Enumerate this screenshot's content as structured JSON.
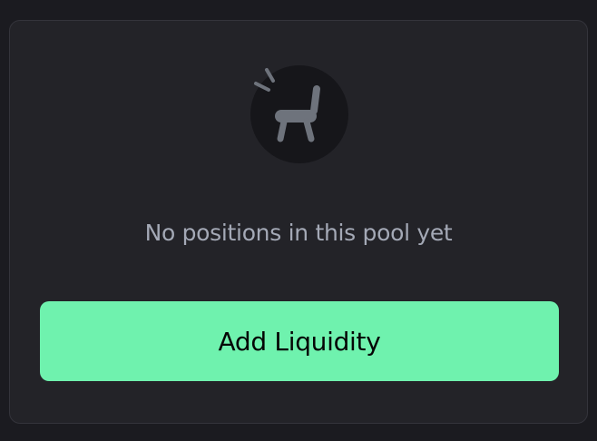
{
  "empty_state": {
    "icon": "broken-chair-icon",
    "message": "No positions in this pool yet"
  },
  "actions": {
    "add_liquidity_label": "Add Liquidity"
  },
  "colors": {
    "page_background": "#1b1b20",
    "card_background": "#232328",
    "card_border": "#34343b",
    "icon_background": "#16161a",
    "icon_color": "#6e737c",
    "message_text": "#a4a9b6",
    "button_background": "#6ff2ae",
    "button_text": "#050505"
  }
}
